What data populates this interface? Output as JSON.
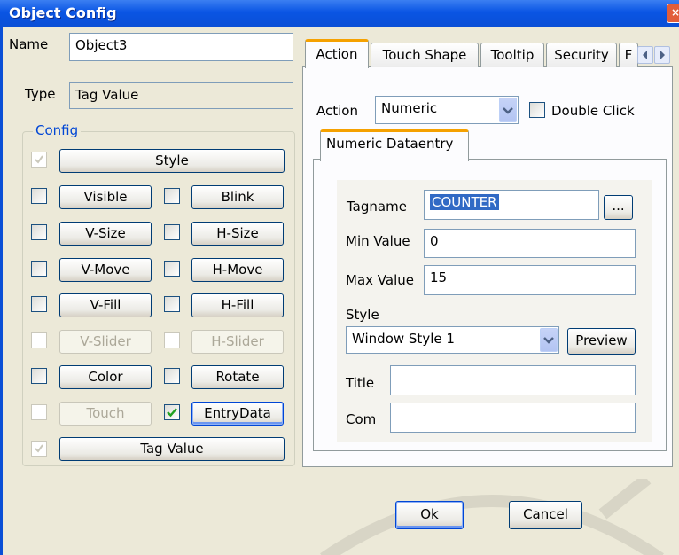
{
  "window": {
    "title": "Object Config",
    "close_glyph": "×"
  },
  "name": {
    "label": "Name",
    "value": "Object3"
  },
  "type": {
    "label": "Type",
    "value": "Tag Value"
  },
  "config": {
    "group_label": "Config",
    "style_label": "Style",
    "rows": [
      {
        "left": "Visible",
        "right": "Blink"
      },
      {
        "left": "V-Size",
        "right": "H-Size"
      },
      {
        "left": "V-Move",
        "right": "H-Move"
      },
      {
        "left": "V-Fill",
        "right": "H-Fill"
      },
      {
        "left": "V-Slider",
        "right": "H-Slider"
      },
      {
        "left": "Color",
        "right": "Rotate"
      },
      {
        "left": "Touch",
        "right": "EntryData"
      }
    ],
    "tag_value_label": "Tag Value"
  },
  "tabs": [
    "Action",
    "Touch Shape",
    "Tooltip",
    "Security",
    "F"
  ],
  "action": {
    "label": "Action",
    "value": "Numeric",
    "double_click_label": "Double Click"
  },
  "subtab": {
    "label": "Numeric Dataentry"
  },
  "numeric": {
    "tagname_label": "Tagname",
    "tagname_value": "COUNTER",
    "browse_label": "...",
    "min_label": "Min Value",
    "min_value": "0",
    "max_label": "Max Value",
    "max_value": "15",
    "style_label": "Style",
    "style_value": "Window Style 1",
    "preview_label": "Preview",
    "title_label": "Title",
    "title_value": "",
    "com_label": "Com",
    "com_value": ""
  },
  "buttons": {
    "ok": "Ok",
    "cancel": "Cancel"
  },
  "colors": {
    "titlebar": "#0a55e4",
    "dialog_bg": "#ece9d8",
    "tab_highlight": "#f5a100",
    "selection": "#316ac5"
  }
}
